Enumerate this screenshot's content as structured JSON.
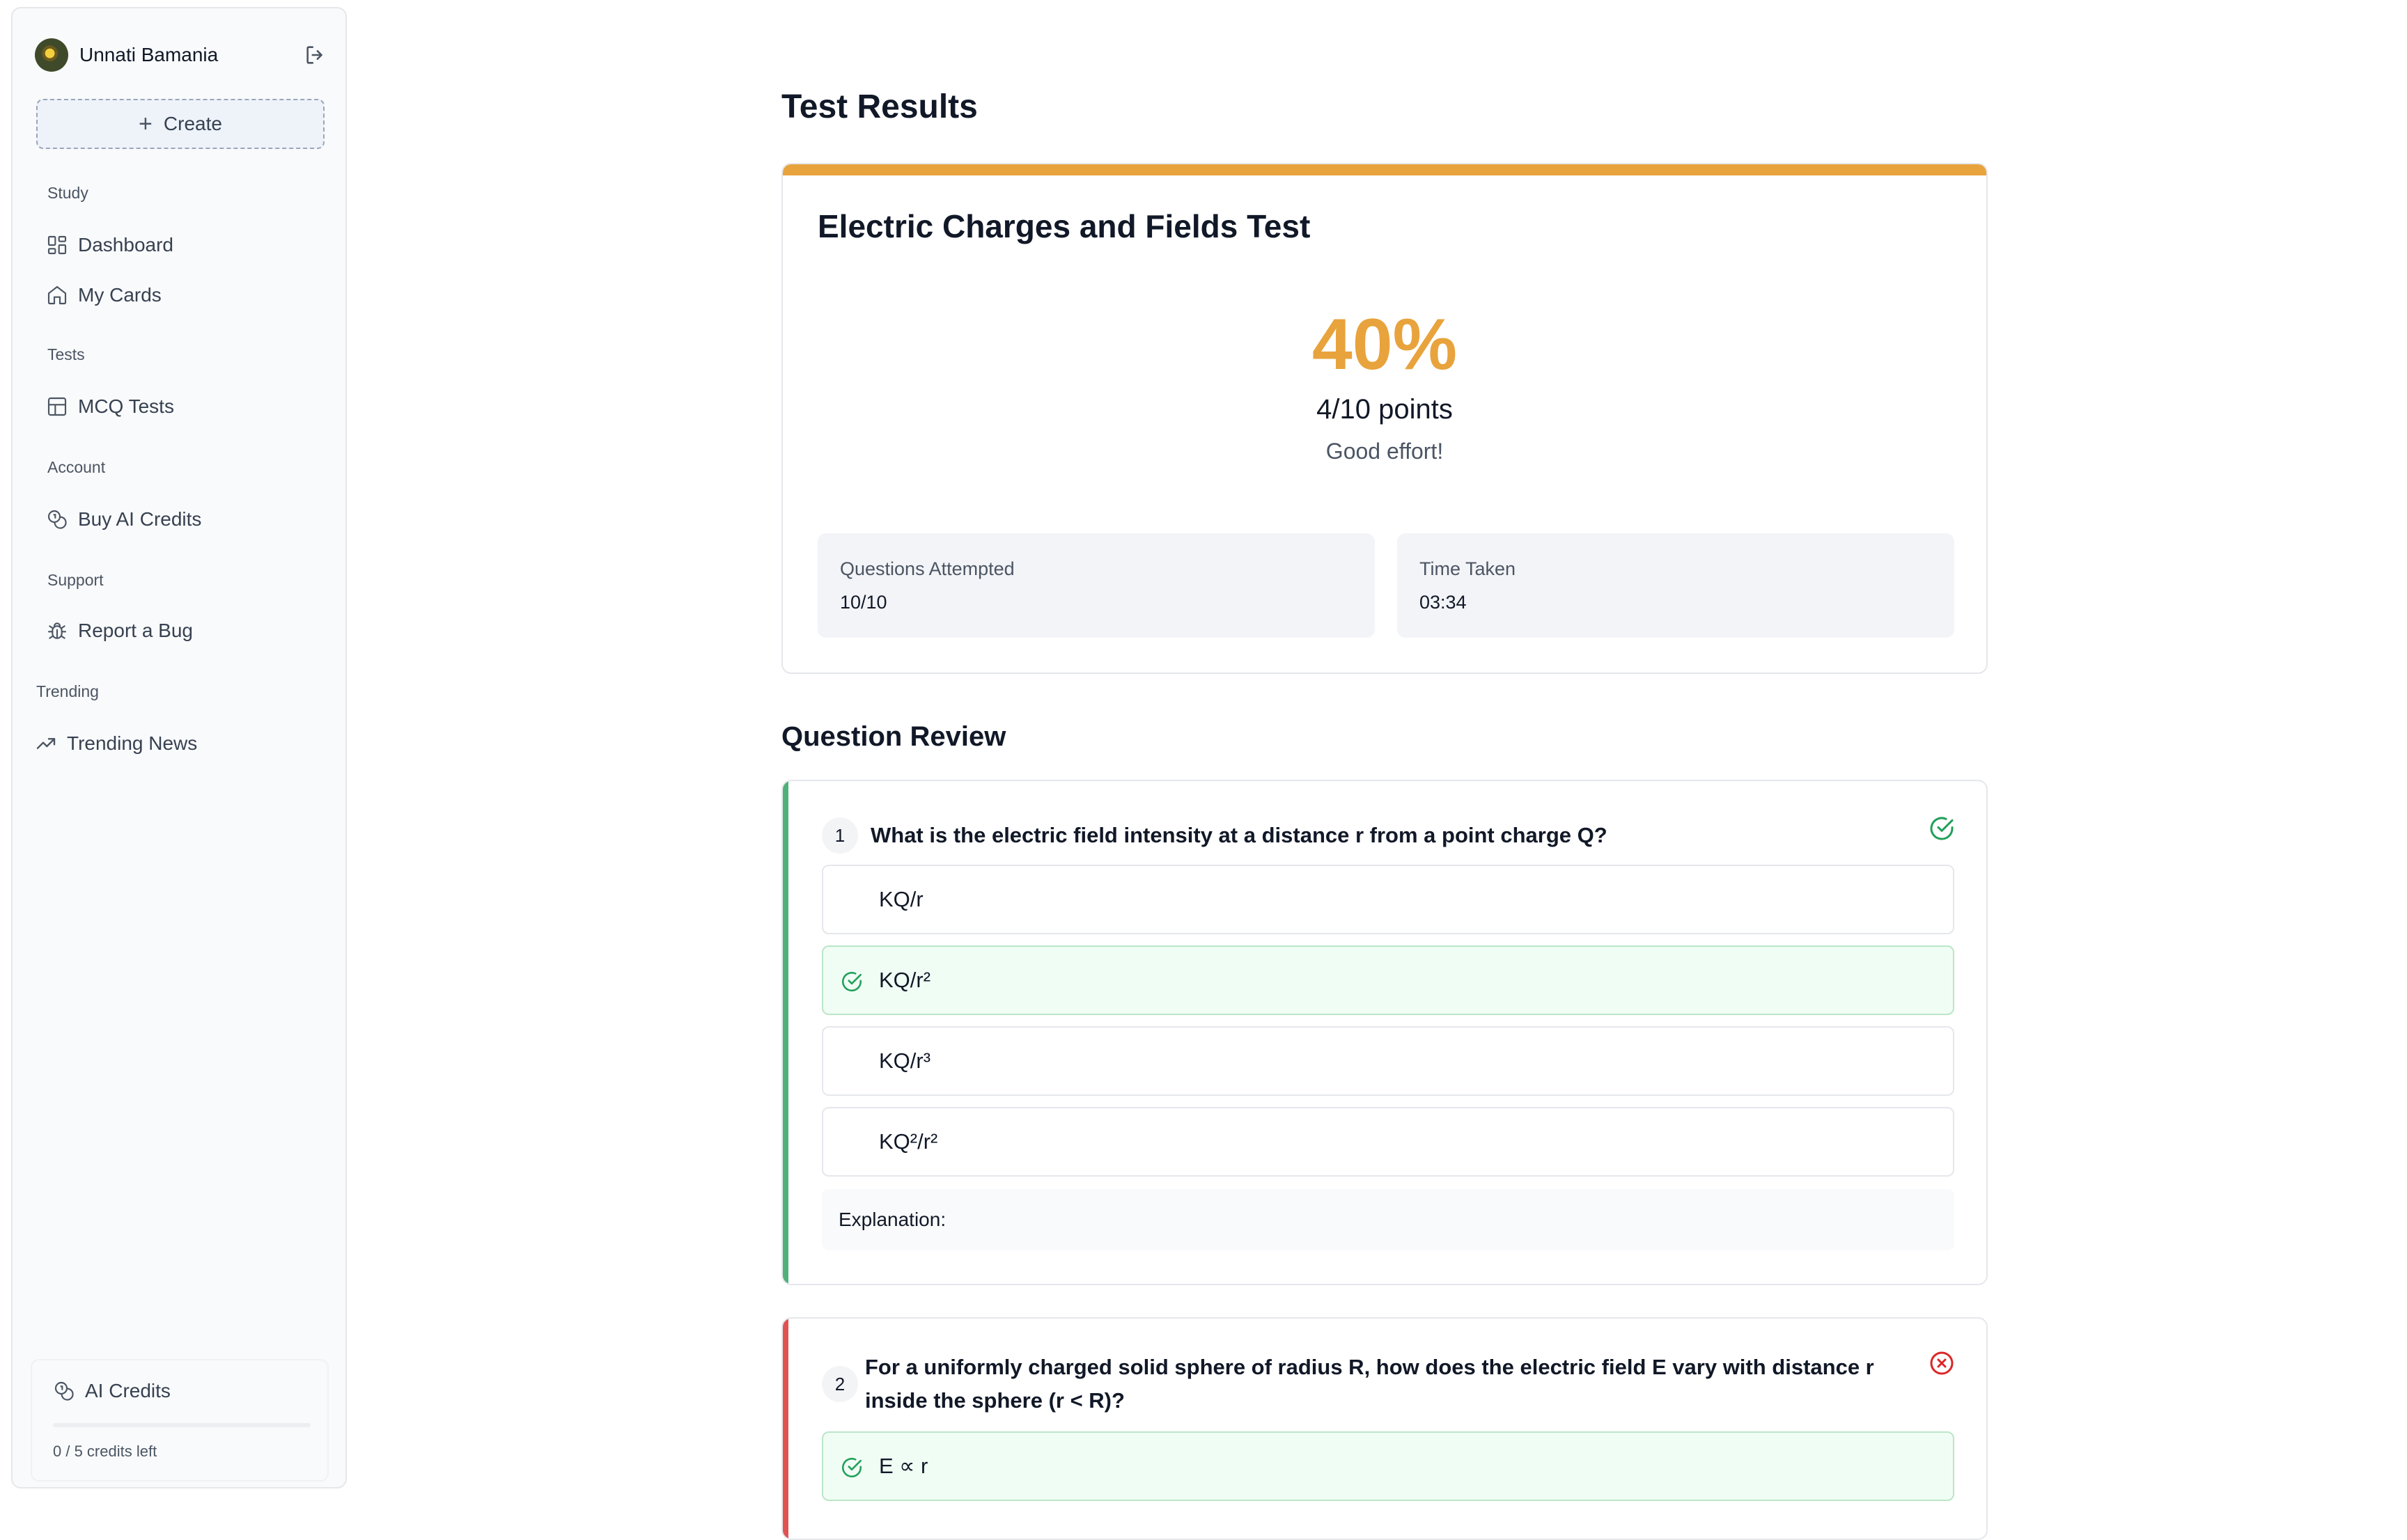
{
  "sidebar": {
    "user_name": "Unnati Bamania",
    "create_label": "Create",
    "sections": [
      {
        "label": "Study",
        "items": [
          "Dashboard",
          "My Cards"
        ]
      },
      {
        "label": "Tests",
        "items": [
          "MCQ Tests"
        ]
      },
      {
        "label": "Account",
        "items": [
          "Buy AI Credits"
        ]
      },
      {
        "label": "Support",
        "items": [
          "Report a Bug"
        ]
      },
      {
        "label": "Trending",
        "items": [
          "Trending News"
        ]
      }
    ],
    "credits": {
      "title": "AI Credits",
      "text": "0 / 5 credits left",
      "used_fraction": 0
    }
  },
  "main": {
    "title": "Test Results",
    "accent_color": "#e8a33c",
    "result": {
      "test_title": "Electric Charges and Fields Test",
      "score_percent": "40%",
      "points": "4/10 points",
      "feedback": "Good effort!",
      "stats": [
        {
          "label": "Questions Attempted",
          "value": "10/10"
        },
        {
          "label": "Time Taken",
          "value": "03:34"
        }
      ]
    },
    "review_title": "Question Review",
    "questions": [
      {
        "number": "1",
        "text": "What is the electric field intensity at a distance r from a point charge Q?",
        "status": "correct",
        "options": [
          "KQ/r",
          "KQ/r²",
          "KQ/r³",
          "KQ²/r²"
        ],
        "correct_option_index": 1,
        "explanation_label": "Explanation:"
      },
      {
        "number": "2",
        "text": "For a uniformly charged solid sphere of radius R, how does the electric field E vary with distance r inside the sphere (r < R)?",
        "status": "incorrect",
        "options": [
          "E ∝ r"
        ],
        "correct_option_index": 0
      }
    ]
  },
  "colors": {
    "correct": "#22a05a",
    "incorrect": "#dc2626",
    "correct_bg": "#f0fdf4"
  }
}
